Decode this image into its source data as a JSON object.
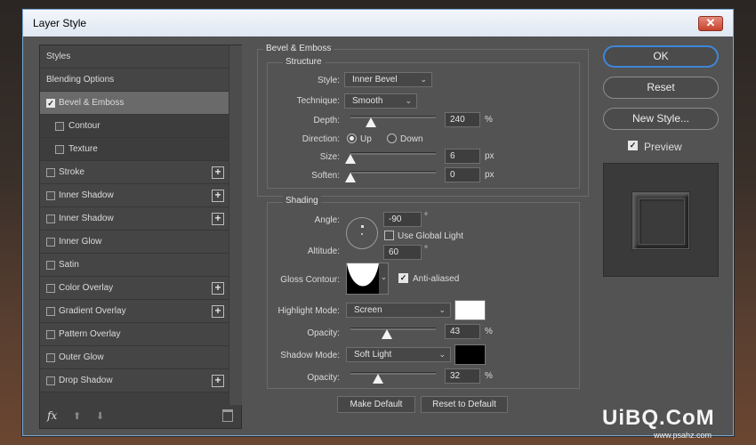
{
  "window": {
    "title": "Layer Style",
    "close": "✕"
  },
  "styles_list": [
    {
      "label": "Styles"
    },
    {
      "label": "Blending Options"
    },
    {
      "label": "Bevel & Emboss",
      "checked": true,
      "selected": true
    },
    {
      "label": "Contour",
      "checked": false,
      "indent": true
    },
    {
      "label": "Texture",
      "checked": false,
      "indent": true
    },
    {
      "label": "Stroke",
      "checked": false,
      "plus": "+"
    },
    {
      "label": "Inner Shadow",
      "checked": false,
      "plus": "+"
    },
    {
      "label": "Inner Shadow",
      "checked": false,
      "plus": "+"
    },
    {
      "label": "Inner Glow",
      "checked": false
    },
    {
      "label": "Satin",
      "checked": false
    },
    {
      "label": "Color Overlay",
      "checked": false,
      "plus": "+"
    },
    {
      "label": "Gradient Overlay",
      "checked": false,
      "plus": "+"
    },
    {
      "label": "Pattern Overlay",
      "checked": false
    },
    {
      "label": "Outer Glow",
      "checked": false
    },
    {
      "label": "Drop Shadow",
      "checked": false,
      "plus": "+"
    }
  ],
  "left_tools": {
    "fx": "fx",
    "up": "⬆",
    "down": "⬇",
    "trash": "🗑"
  },
  "bevel": {
    "group_title": "Bevel & Emboss",
    "structure_title": "Structure",
    "style_label": "Style:",
    "style_value": "Inner Bevel",
    "technique_label": "Technique:",
    "technique_value": "Smooth",
    "depth_label": "Depth:",
    "depth_value": "240",
    "depth_unit": "%",
    "direction_label": "Direction:",
    "direction_up": "Up",
    "direction_down": "Down",
    "size_label": "Size:",
    "size_value": "6",
    "size_unit": "px",
    "soften_label": "Soften:",
    "soften_value": "0",
    "soften_unit": "px"
  },
  "shading": {
    "title": "Shading",
    "angle_label": "Angle:",
    "angle_value": "-90",
    "angle_unit": "°",
    "global_light_label": "Use Global Light",
    "altitude_label": "Altitude:",
    "altitude_value": "60",
    "altitude_unit": "°",
    "gloss_label": "Gloss Contour:",
    "anti_aliased_label": "Anti-aliased",
    "highlight_mode_label": "Highlight Mode:",
    "highlight_mode_value": "Screen",
    "highlight_color": "#ffffff",
    "highlight_opacity_label": "Opacity:",
    "highlight_opacity_value": "43",
    "shadow_mode_label": "Shadow Mode:",
    "shadow_mode_value": "Soft Light",
    "shadow_color": "#000000",
    "shadow_opacity_label": "Opacity:",
    "shadow_opacity_value": "32",
    "percent": "%"
  },
  "buttons": {
    "make_default": "Make Default",
    "reset_to_default": "Reset to Default",
    "ok": "OK",
    "reset": "Reset",
    "new_style": "New Style...",
    "preview_label": "Preview"
  },
  "watermark": {
    "main": "UiBQ.CoM",
    "sub": "www.psahz.com"
  },
  "colors": {
    "accent": "#3e86d8",
    "panel": "#535353"
  },
  "slider_levels": {
    "depth": 0.24,
    "size": 0.0,
    "soften": 0.0,
    "highlight_opacity": 0.43,
    "shadow_opacity": 0.32
  }
}
